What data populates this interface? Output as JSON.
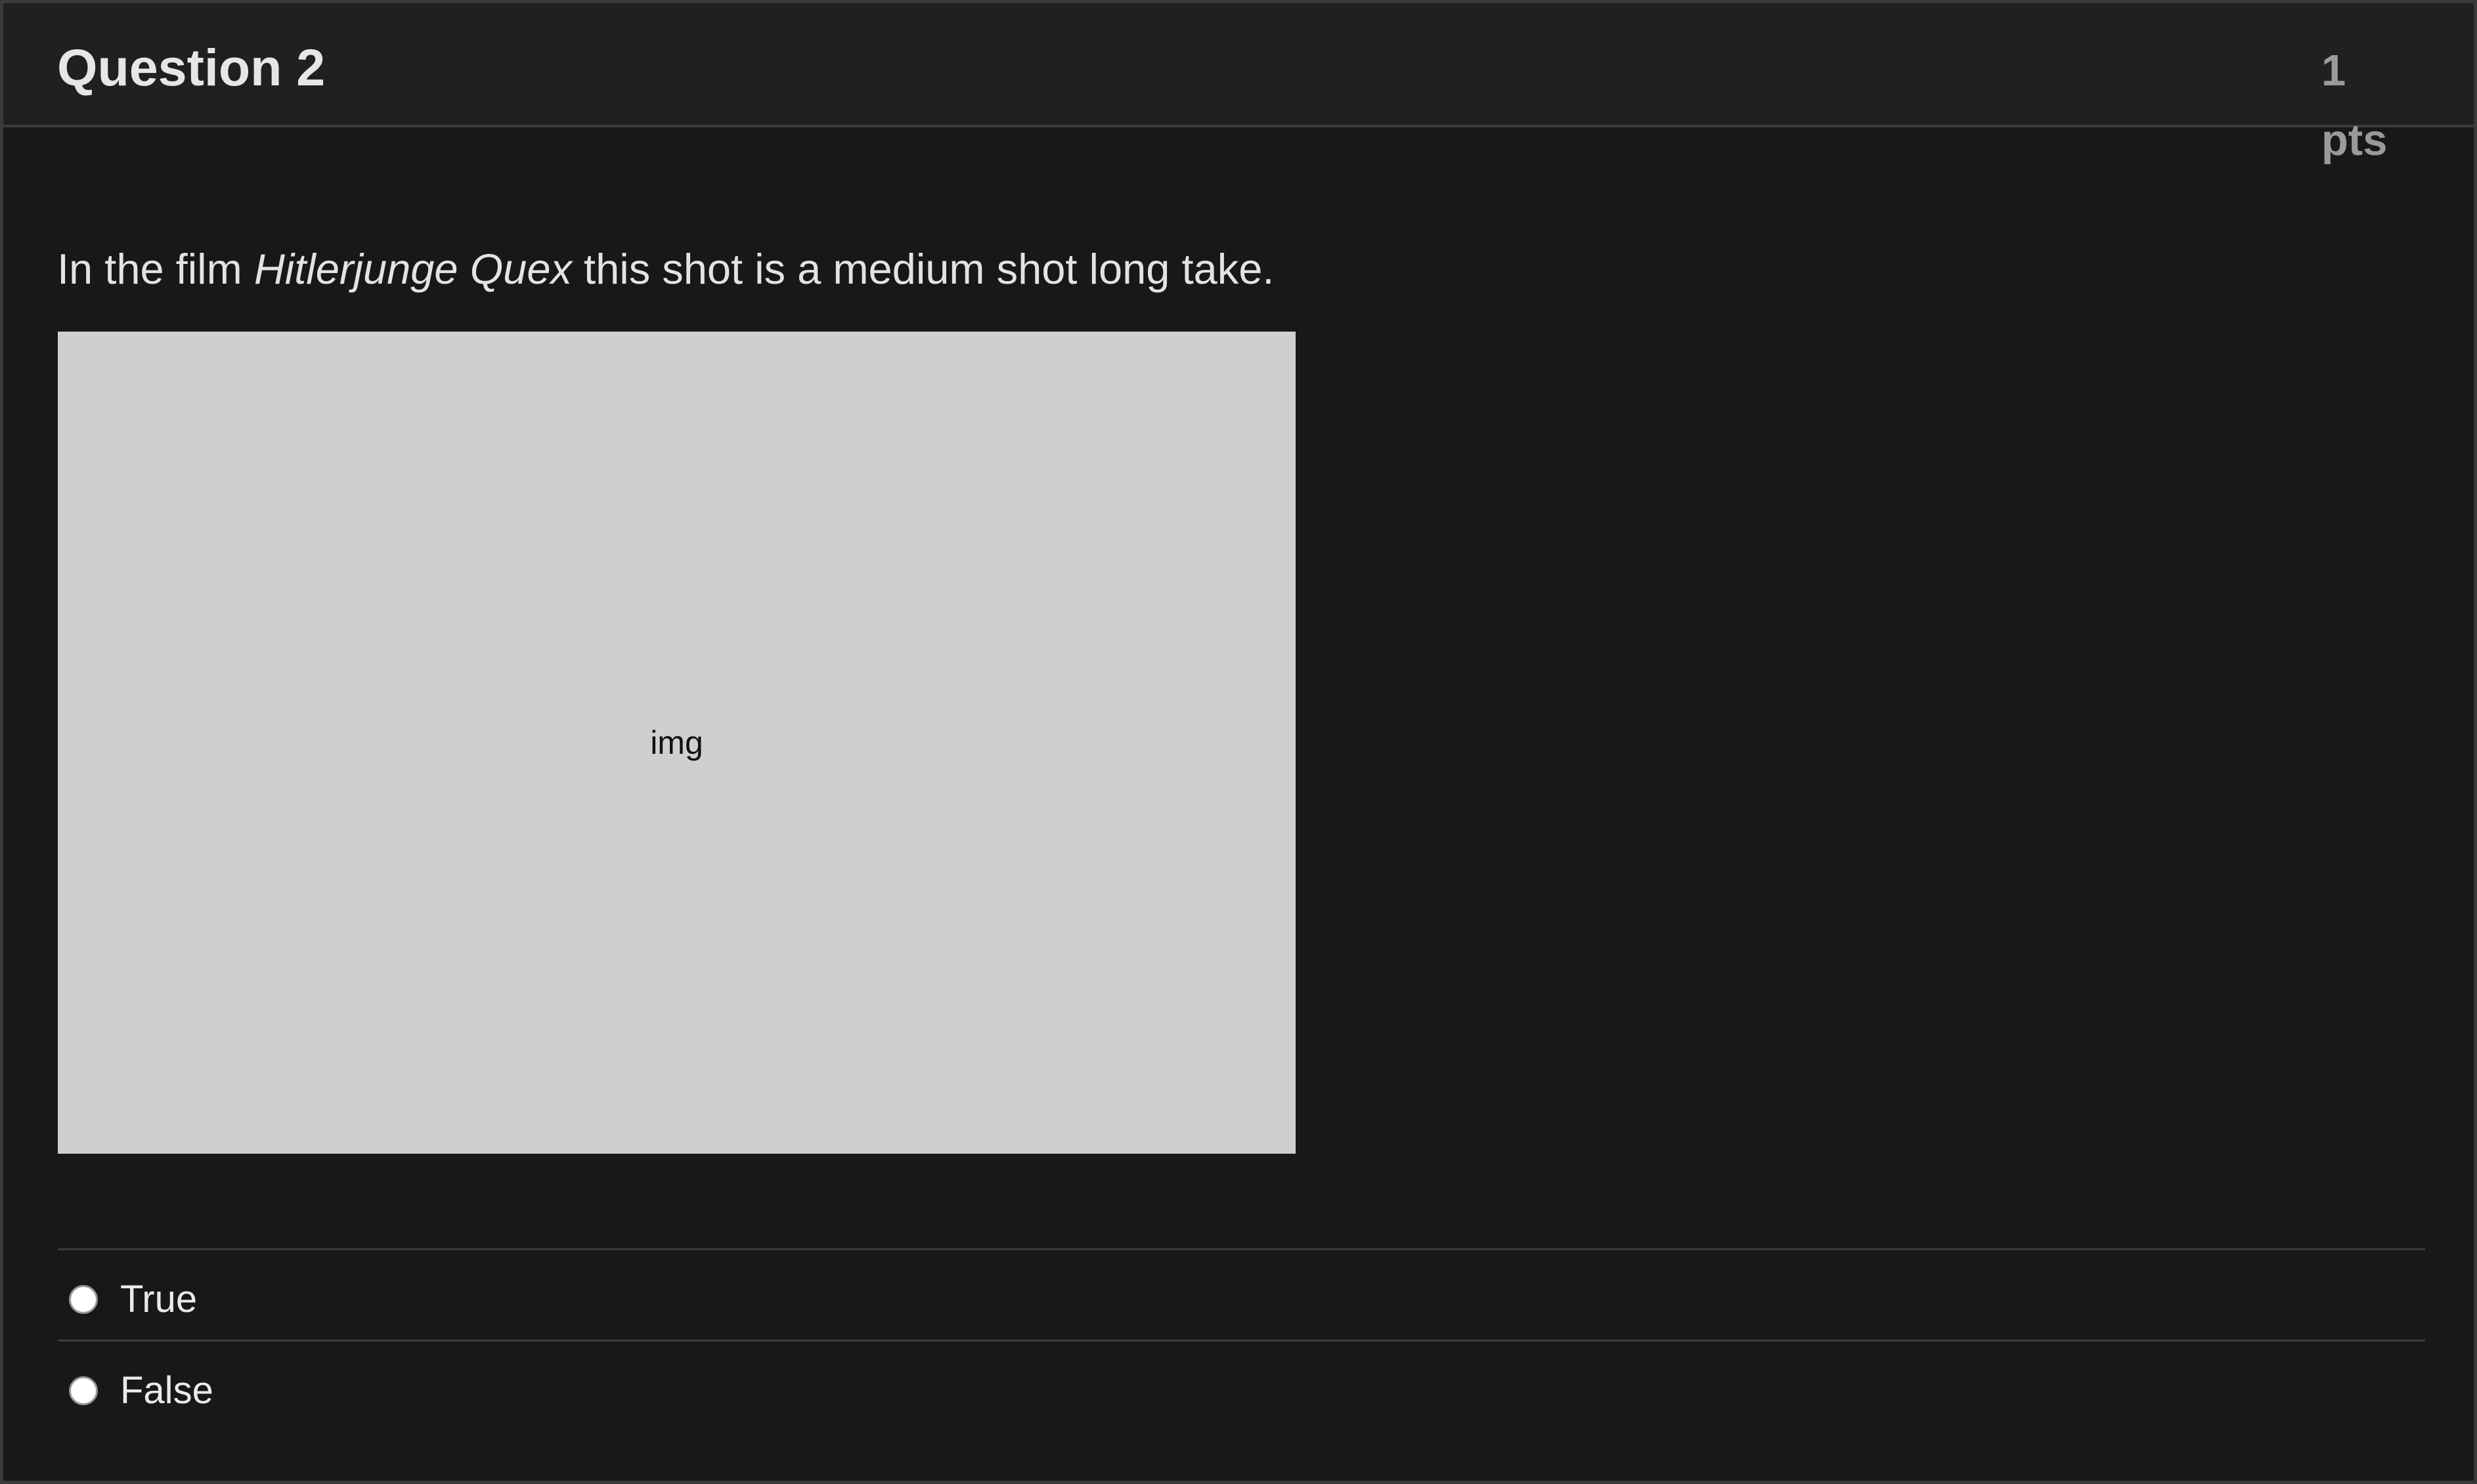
{
  "question": {
    "title": "Question 2",
    "points_value": "1",
    "points_unit": "pts",
    "text_before": "In the film ",
    "text_italic": "Hitlerjunge Quex",
    "text_after": " this shot is a medium shot long take.",
    "image_placeholder": "img"
  },
  "answers": [
    {
      "label": "True",
      "selected": false
    },
    {
      "label": "False",
      "selected": false
    }
  ],
  "colors": {
    "background": "#181818",
    "header": "#202020",
    "image_placeholder": "#cfcfcf"
  }
}
